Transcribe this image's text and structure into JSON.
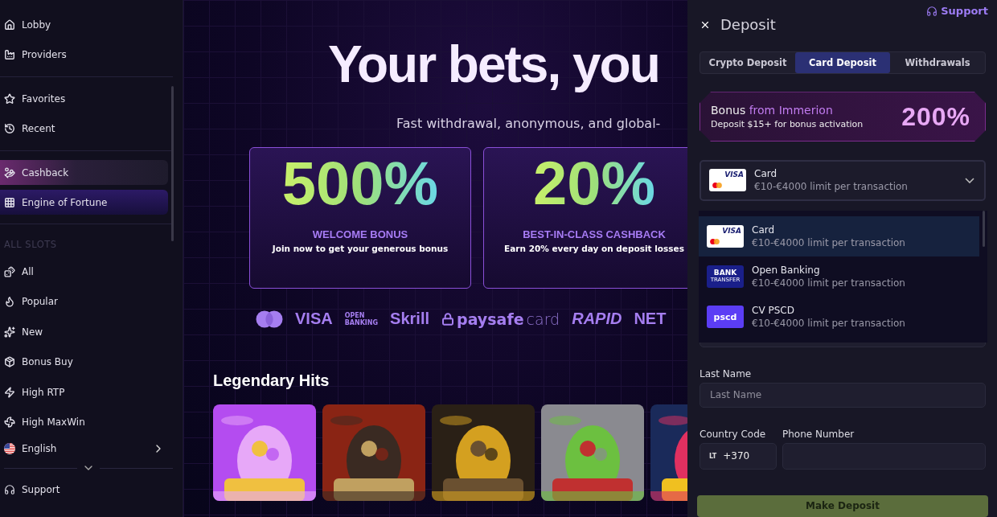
{
  "sidebar": {
    "sections": [
      {
        "items": [
          {
            "label": "Lobby",
            "kind": "link"
          },
          {
            "label": "Providers",
            "kind": "link"
          }
        ]
      },
      {
        "items": [
          {
            "label": "Favorites",
            "kind": "link"
          },
          {
            "label": "Recent",
            "kind": "link"
          }
        ]
      },
      {
        "items": [
          {
            "label": "Cashback",
            "kind": "glow"
          },
          {
            "label": "Engine of Fortune",
            "kind": "banner"
          }
        ]
      },
      {
        "heading": "ALL SLOTS",
        "items": [
          {
            "label": "All",
            "kind": "link"
          },
          {
            "label": "Popular",
            "kind": "link"
          },
          {
            "label": "New",
            "kind": "link"
          },
          {
            "label": "Bonus Buy",
            "kind": "link"
          },
          {
            "label": "High RTP",
            "kind": "link"
          },
          {
            "label": "High MaxWin",
            "kind": "link"
          }
        ]
      }
    ],
    "language": {
      "label": "English"
    },
    "support": {
      "label": "Support"
    }
  },
  "hero": {
    "title": "Your bets, you",
    "subtitle": "Fast withdrawal, anonymous, and global-",
    "promos": [
      {
        "percent": "500%",
        "title": "WELCOME BONUS",
        "subtitle": "Join now to get your generous bonus"
      },
      {
        "percent": "20%",
        "title": "BEST-IN-CLASS CASHBACK",
        "subtitle": "Earn 20% every day on deposit losses"
      }
    ],
    "payment_logos": [
      {
        "kind": "circles"
      },
      {
        "kind": "bold",
        "text": "VISA"
      },
      {
        "kind": "stacked",
        "lines": [
          "OPEN",
          "BANKING"
        ]
      },
      {
        "kind": "bold",
        "text": "Skrill"
      },
      {
        "kind": "lock",
        "text": "paysafe",
        "suffix": "card"
      },
      {
        "kind": "slanted",
        "text": "RAPID"
      },
      {
        "kind": "bold",
        "text": "NET"
      }
    ]
  },
  "games_section": {
    "title": "Legendary Hits"
  },
  "drawer": {
    "title": "Deposit",
    "support": "Support",
    "tabs": [
      {
        "label": "Crypto Deposit",
        "selected": false
      },
      {
        "label": "Card Deposit",
        "selected": true
      },
      {
        "label": "Withdrawals",
        "selected": false
      }
    ],
    "bonus": {
      "title": "Bonus **from Immerion**",
      "subtitle": "Deposit $15+ for bonus activation",
      "percent": "200%"
    },
    "method_select": {
      "expanded": true,
      "logo": {
        "kind": "card",
        "text": "VISA"
      },
      "title": "Card",
      "subtitle": "€10-€4000 limit per transaction"
    },
    "methods": [
      {
        "title": "Card",
        "subtitle": "€10-€4000 limit per transaction",
        "selected": true,
        "logo": {
          "kind": "card",
          "text": "VISA"
        }
      },
      {
        "title": "Open Banking",
        "subtitle": "€10-€4000 limit per transaction",
        "selected": false,
        "logo": {
          "kind": "bank",
          "text": "BANK",
          "subtext": "TRANSFER"
        }
      },
      {
        "title": "CV PSCD",
        "subtitle": "€10-€4000 limit per transaction",
        "selected": false,
        "logo": {
          "kind": "tile",
          "text": "pscd"
        }
      }
    ],
    "last_name": {
      "label": "Last Name",
      "placeholder": "Last Name"
    },
    "country_code": {
      "label": "Country Code",
      "flag": "LT",
      "value": "+370"
    },
    "phone": {
      "label": "Phone Number"
    },
    "submit": "Make Deposit"
  }
}
